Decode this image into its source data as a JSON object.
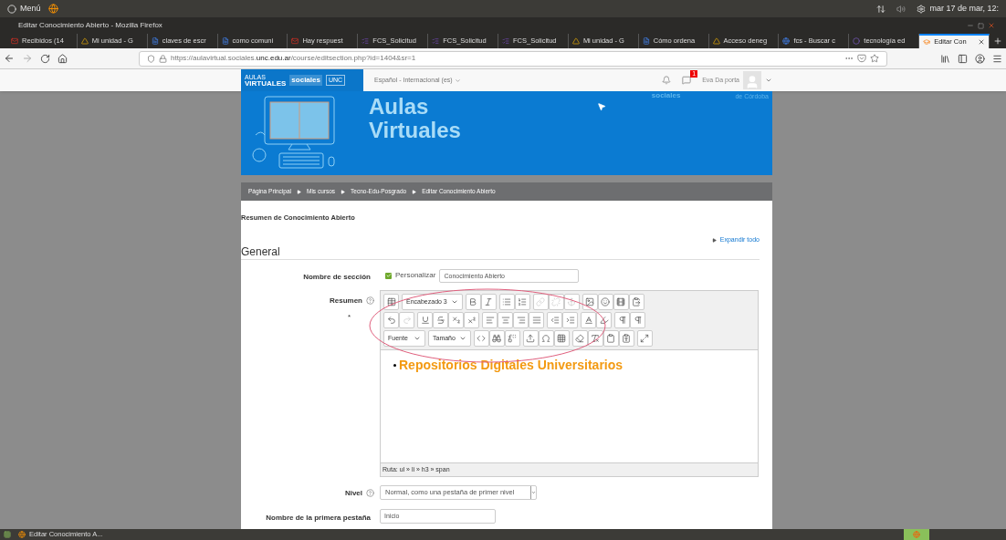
{
  "os_bar": {
    "menu": "Menú",
    "clock": "mar 17 de mar, 12:"
  },
  "window": {
    "title": "Editar Conocimiento Abierto - Mozilla Firefox"
  },
  "tabs": [
    {
      "label": "Recibidos (14",
      "kind": "mail",
      "selected": false
    },
    {
      "label": "Mi unidad - G",
      "kind": "drive",
      "selected": false
    },
    {
      "label": "claves de escr",
      "kind": "doc",
      "selected": false
    },
    {
      "label": "como comuni",
      "kind": "doc",
      "selected": false
    },
    {
      "label": "Hay respuest",
      "kind": "mail",
      "selected": false
    },
    {
      "label": "FCS_Solicitud",
      "kind": "form",
      "selected": false
    },
    {
      "label": "FCS_Solicitud",
      "kind": "form",
      "selected": false
    },
    {
      "label": "FCS_Solicitud",
      "kind": "form",
      "selected": false
    },
    {
      "label": "Mi unidad - G",
      "kind": "drive",
      "selected": false
    },
    {
      "label": "Cómo ordena",
      "kind": "doc",
      "selected": false
    },
    {
      "label": "Acceso deneg",
      "kind": "drive",
      "selected": false
    },
    {
      "label": "fcs - Buscar c",
      "kind": "google",
      "selected": false
    },
    {
      "label": "tecnología ed",
      "kind": "generic",
      "selected": false
    },
    {
      "label": "Editar Con",
      "kind": "moodle",
      "selected": true
    }
  ],
  "address_bar": {
    "url": "https://aulavirtual.sociales.**unc.edu.ar**/course/editsection.php?id=1404&sr=1"
  },
  "site_header": {
    "logo_top": "AULAS",
    "logo_bottom": "VIRTUALES",
    "logo_faculty": "sociales",
    "logo_unc": "UNC",
    "language": "Español - Internacional (es)",
    "messages_badge": "1",
    "user": "Eva Da porta"
  },
  "banner": {
    "title_line1": "Aulas",
    "title_line2": "Virtuales",
    "faculty": "sociales",
    "university": "de Córdoba"
  },
  "breadcrumb": [
    "Página Principal",
    "Mis cursos",
    "Tecno-Edu-Posgrado",
    "Editar Conocimiento Abierto"
  ],
  "page": {
    "heading": "Resumen de Conocimiento Abierto",
    "expand_all": "Expandir todo",
    "section": "General"
  },
  "form": {
    "section_name": {
      "label": "Nombre de sección",
      "customize_label": "Personalizar",
      "checked": true,
      "value": "Conocimiento Abierto"
    },
    "summary": {
      "label": "Resumen",
      "required_mark": "*",
      "toolbar": [
        [
          [
            {
              "kind": "wordtoggle",
              "disabled": false
            }
          ],
          [
            {
              "kind": "select",
              "label": "Encabezado 3"
            }
          ],
          [
            {
              "kind": "bold",
              "disabled": false
            },
            {
              "kind": "italic",
              "disabled": false
            }
          ],
          [
            {
              "kind": "bullets",
              "disabled": false
            },
            {
              "kind": "numbers",
              "disabled": false
            }
          ],
          [
            {
              "kind": "link",
              "disabled": true
            },
            {
              "kind": "unlink",
              "disabled": true
            },
            {
              "kind": "anchor",
              "disabled": true
            }
          ],
          [
            {
              "kind": "image",
              "disabled": false
            },
            {
              "kind": "emoticon",
              "disabled": false
            },
            {
              "kind": "media",
              "disabled": false
            },
            {
              "kind": "paste",
              "disabled": false
            }
          ]
        ],
        [
          [
            {
              "kind": "undo",
              "disabled": false
            },
            {
              "kind": "redo",
              "disabled": true
            }
          ],
          [
            {
              "kind": "underline",
              "disabled": false
            },
            {
              "kind": "strike",
              "disabled": false
            },
            {
              "kind": "subscript",
              "disabled": false
            },
            {
              "kind": "superscript",
              "disabled": false
            }
          ],
          [
            {
              "kind": "alignleft",
              "disabled": false
            },
            {
              "kind": "aligncenter",
              "disabled": false
            },
            {
              "kind": "alignright",
              "disabled": false
            },
            {
              "kind": "justify",
              "disabled": false
            }
          ],
          [
            {
              "kind": "outdent",
              "disabled": false
            },
            {
              "kind": "indent",
              "disabled": false
            }
          ],
          [
            {
              "kind": "textcolor",
              "disabled": false
            },
            {
              "kind": "bgcolor",
              "disabled": false
            }
          ],
          [
            {
              "kind": "ltr",
              "disabled": false
            },
            {
              "kind": "rtl",
              "disabled": false
            }
          ]
        ],
        [
          [
            {
              "kind": "select",
              "label": "Fuente"
            }
          ],
          [
            {
              "kind": "select",
              "label": "Tamaño"
            }
          ],
          [
            {
              "kind": "code",
              "disabled": false
            },
            {
              "kind": "find",
              "disabled": false
            },
            {
              "kind": "replace",
              "disabled": false
            }
          ],
          [
            {
              "kind": "upload",
              "disabled": false
            },
            {
              "kind": "charmap",
              "disabled": false
            },
            {
              "kind": "table",
              "disabled": false
            }
          ],
          [
            {
              "kind": "cleanup",
              "disabled": false
            },
            {
              "kind": "clearformat",
              "disabled": false
            },
            {
              "kind": "pasteword",
              "disabled": false
            },
            {
              "kind": "pastetext",
              "disabled": false
            }
          ],
          [
            {
              "kind": "fullscreen",
              "disabled": false
            }
          ]
        ]
      ],
      "content": "Repositorios Digitales Universitarios",
      "path": "Ruta: ul » li » h3 » span"
    },
    "level": {
      "label": "Nivel",
      "value": "Normal, como una pestaña de primer nivel"
    },
    "first_tab_name": {
      "label": "Nombre de la primera pestaña",
      "value": "Inicio"
    }
  },
  "taskbar": {
    "window": "Editar Conocimiento A..."
  }
}
